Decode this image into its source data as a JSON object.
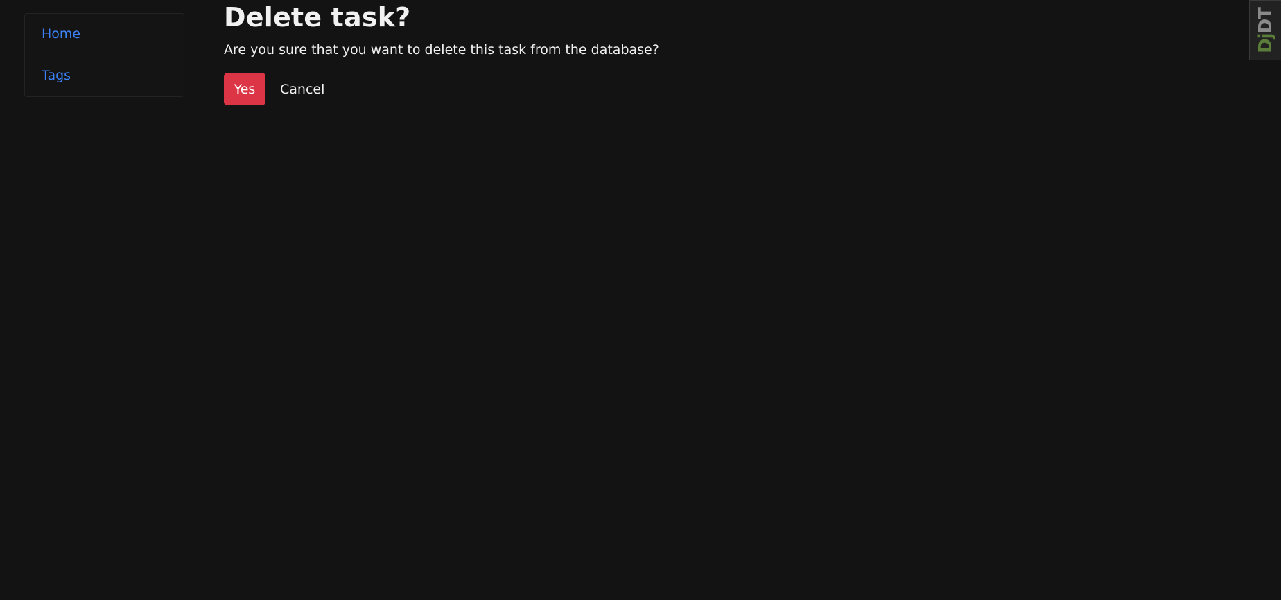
{
  "sidebar": {
    "items": [
      {
        "label": "Home"
      },
      {
        "label": "Tags"
      }
    ]
  },
  "main": {
    "title": "Delete task?",
    "message": "Are you sure that you want to delete this task from the database?",
    "actions": {
      "confirm_label": "Yes",
      "cancel_label": "Cancel"
    }
  },
  "debug_toolbar": {
    "label_prefix": "Dj",
    "label_suffix": "DT"
  },
  "colors": {
    "background": "#131313",
    "link": "#3b82f6",
    "danger": "#dc3545",
    "text": "#f1f1f1"
  }
}
